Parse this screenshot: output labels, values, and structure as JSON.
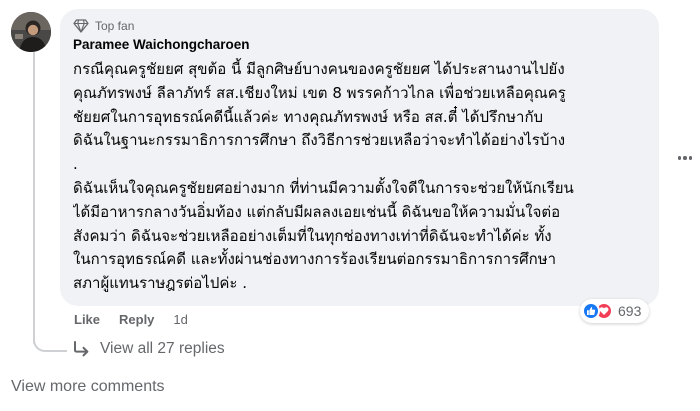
{
  "comment": {
    "badge": {
      "label": "Top fan",
      "icon": "diamond-icon"
    },
    "author": "Paramee Waichongcharoen",
    "body_lines": [
      "กรณีคุณครูชัยยศ สุขต้อ นี้ มีลูกศิษย์บางคนของครูชัยยศ ได้ประสานงานไปยัง",
      "คุณภัทรพงษ์ ลีลาภัทร์ สส.เชียงใหม่ เขต 8 พรรคก้าวไกล เพื่อช่วยเหลือคุณครู",
      "ชัยยศในการอุทธรณ์คดีนี้แล้วค่ะ ทางคุณภัทรพงษ์ หรือ สส.ตี๋ ได้ปรึกษากับ",
      "ดิฉันในฐานะกรรมาธิการการศึกษา ถึงวิธีการช่วยเหลือว่าจะทำได้อย่างไรบ้าง",
      ".",
      "ดิฉันเห็นใจคุณครูชัยยศอย่างมาก ที่ท่านมีความตั้งใจดีในการจะช่วยให้นักเรียน",
      "ได้มีอาหารกลางวันอิ่มท้อง แต่กลับมีผลลงเอยเช่นนี้ ดิฉันขอให้ความมั่นใจต่อ",
      "สังคมว่า ดิฉันจะช่วยเหลืออย่างเต็มที่ในทุกช่องทางเท่าที่ดิฉันจะทำได้ค่ะ ทั้ง",
      "ในการอุทธรณ์คดี และทั้งผ่านช่องทางการร้องเรียนต่อกรรมาธิการการศึกษา",
      "สภาผู้แทนราษฎรต่อไปค่ะ ."
    ],
    "reactions": {
      "count": "693",
      "icons": [
        "like-icon",
        "love-icon"
      ],
      "colors": {
        "like": "#1877f2",
        "love": "#f33e58"
      }
    },
    "actions": {
      "like_label": "Like",
      "reply_label": "Reply",
      "time": "1d"
    }
  },
  "view_replies": {
    "label": "View all 27 replies",
    "icon": "reply-arrow-icon"
  },
  "view_more_label": "View more comments",
  "colors": {
    "bubble": "#f0f2f5",
    "secondary_text": "#65676b",
    "primary_text": "#050505",
    "thread_line": "#ced0d4"
  }
}
